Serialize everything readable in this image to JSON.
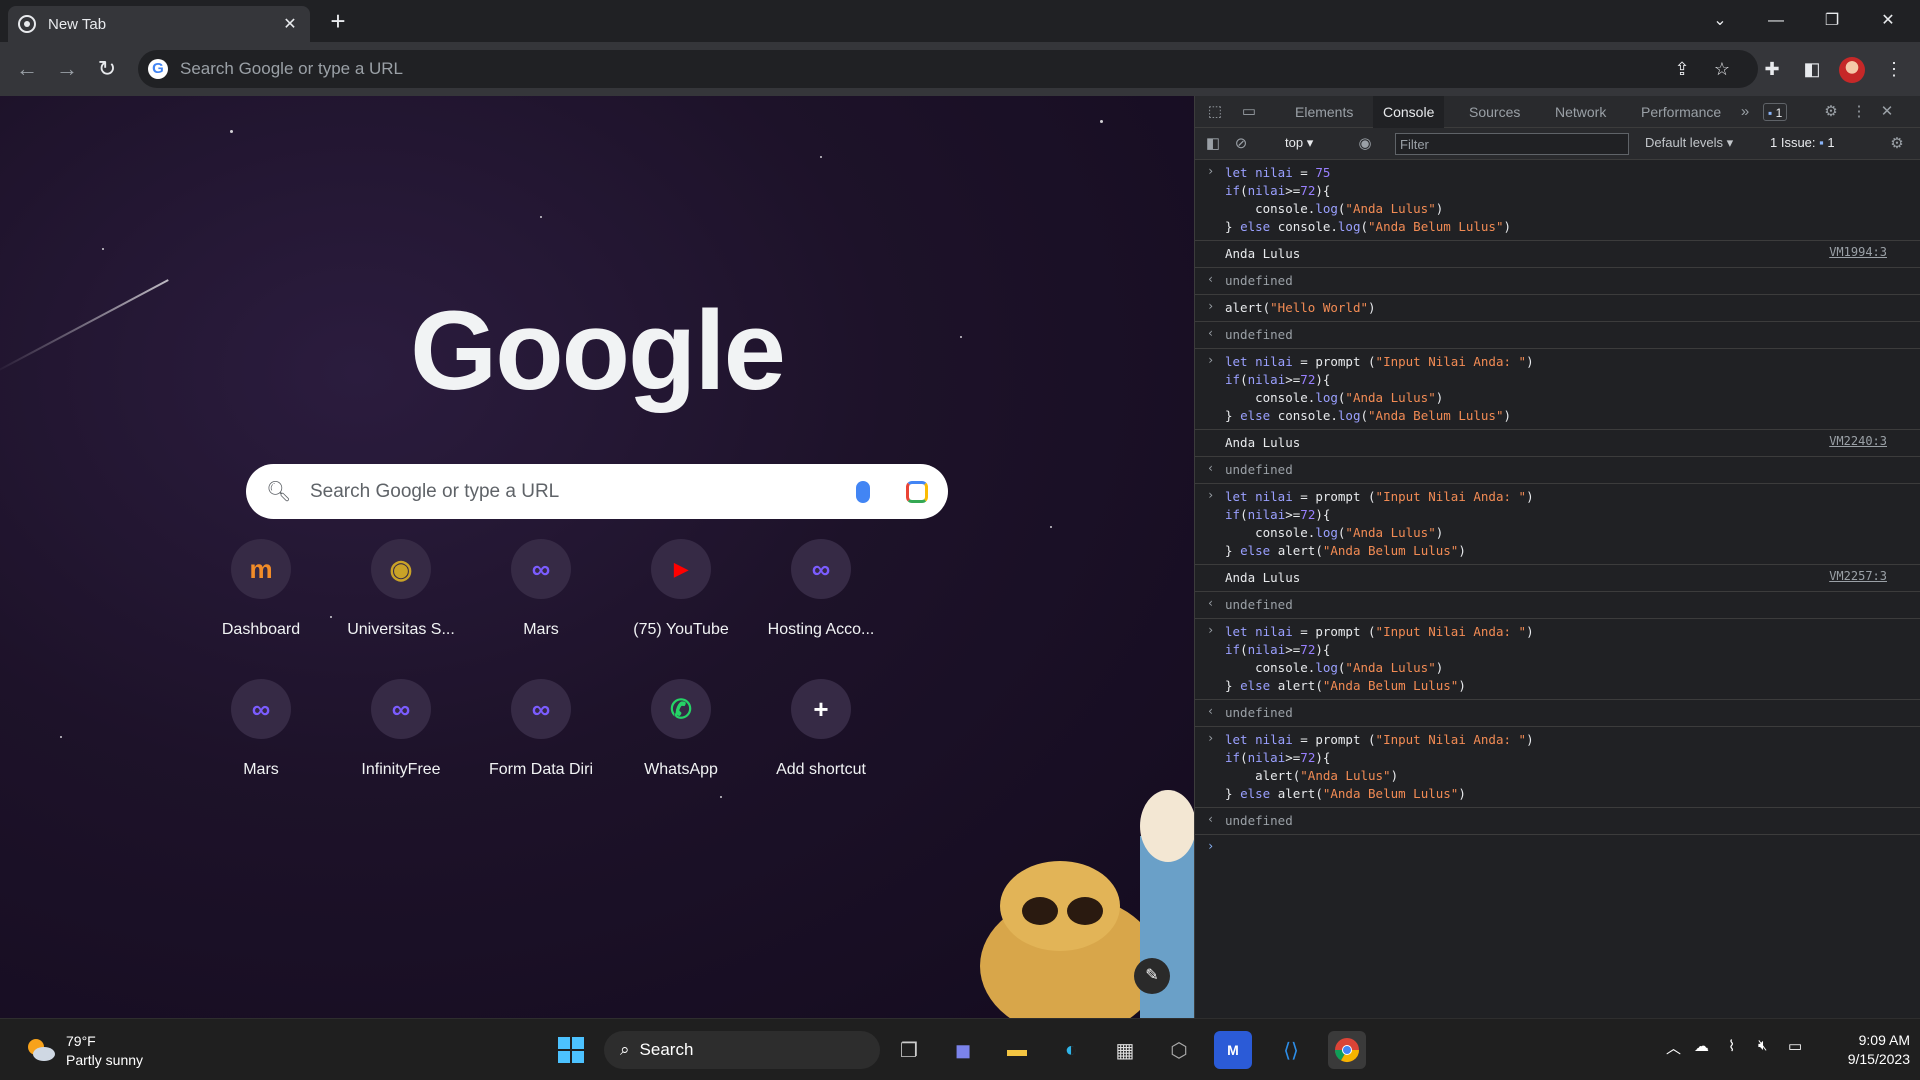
{
  "browser": {
    "tab_title": "New Tab",
    "omnibox_placeholder": "Search Google or type a URL"
  },
  "ntp": {
    "logo_text": "Google",
    "search_placeholder": "Search Google or type a URL",
    "shortcuts": [
      {
        "label": "Dashboard",
        "icon": "m-icon",
        "glyph": "m",
        "color": "#f28c28"
      },
      {
        "label": "Universitas S...",
        "icon": "university-seal-icon",
        "glyph": "◉",
        "color": "#c9a227"
      },
      {
        "label": "Mars",
        "icon": "infinity-icon",
        "glyph": "∞",
        "color": "#7b5cff"
      },
      {
        "label": "(75) YouTube",
        "icon": "youtube-icon",
        "glyph": "▶",
        "color": "#ff0000"
      },
      {
        "label": "Hosting Acco...",
        "icon": "infinity-icon",
        "glyph": "∞",
        "color": "#7b5cff"
      },
      {
        "label": "Mars",
        "icon": "infinity-icon",
        "glyph": "∞",
        "color": "#7b5cff"
      },
      {
        "label": "InfinityFree",
        "icon": "infinity-icon",
        "glyph": "∞",
        "color": "#7b5cff"
      },
      {
        "label": "Form Data Diri",
        "icon": "infinity-icon",
        "glyph": "∞",
        "color": "#7b5cff"
      },
      {
        "label": "WhatsApp",
        "icon": "whatsapp-icon",
        "glyph": "✆",
        "color": "#25d366"
      },
      {
        "label": "Add shortcut",
        "icon": "plus-icon",
        "glyph": "+",
        "color": "#ffffff"
      }
    ]
  },
  "devtools": {
    "tabs": [
      "Elements",
      "Console",
      "Sources",
      "Network",
      "Performance"
    ],
    "active_tab": "Console",
    "messages_badge": "1",
    "context": "top",
    "filter_placeholder": "Filter",
    "levels": "Default levels",
    "issues_label": "1 Issue:",
    "issues_count": "1",
    "undefined_text": "undefined",
    "output_text": "Anda Lulus",
    "sources": [
      "VM1994:3",
      "VM2240:3",
      "VM2257:3"
    ]
  },
  "taskbar": {
    "temperature": "79°F",
    "weather": "Partly sunny",
    "search_label": "Search",
    "time": "9:09 AM",
    "date": "9/15/2023"
  }
}
